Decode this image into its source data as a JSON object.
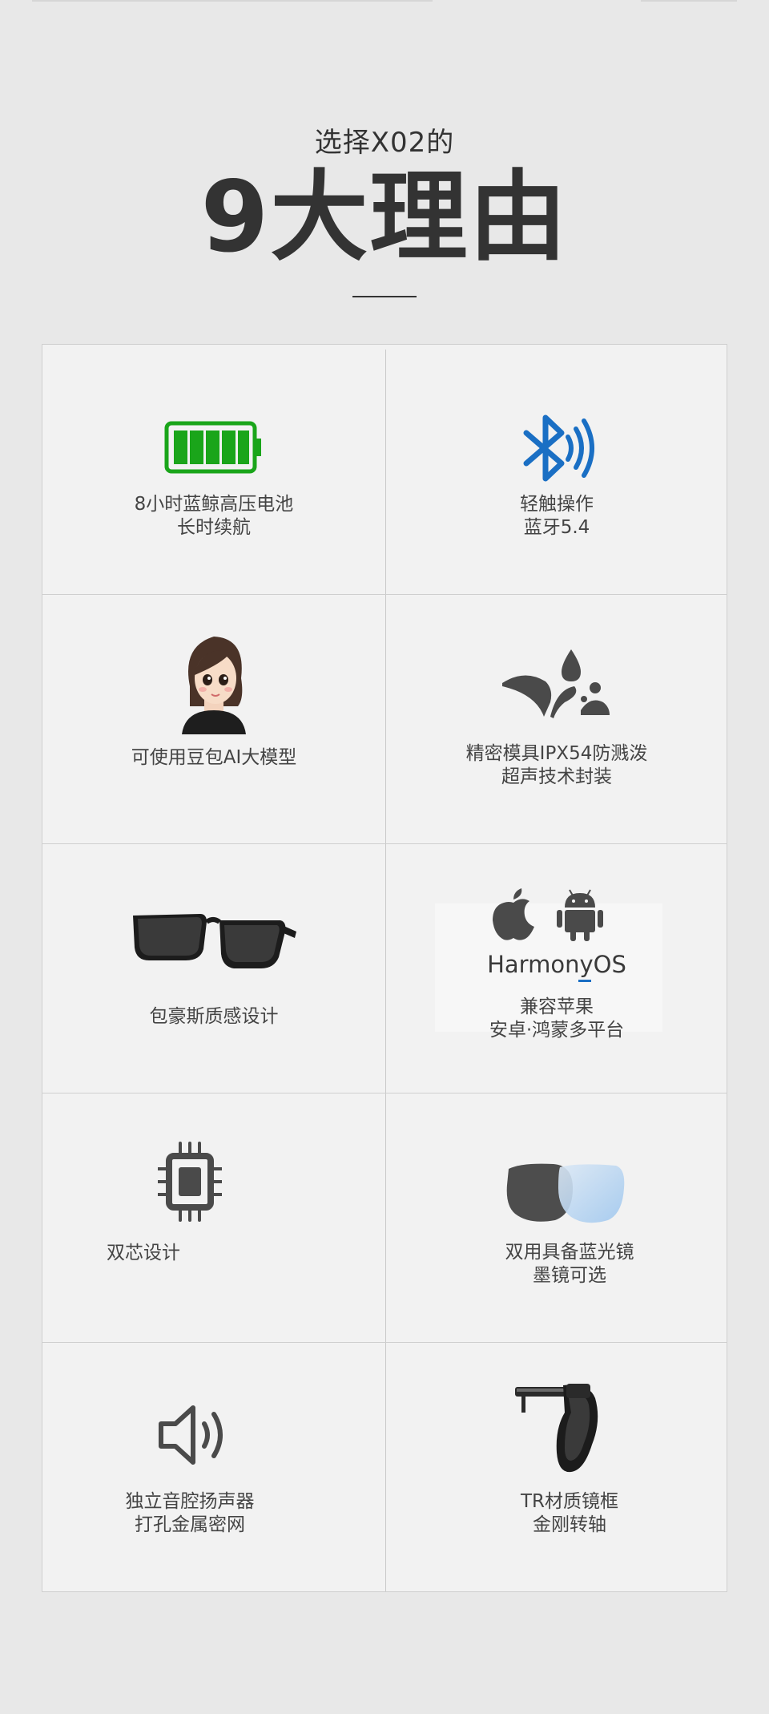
{
  "header": {
    "subtitle": "选择X02的",
    "title": "9大理由"
  },
  "features": [
    {
      "line1": "8小时蓝鲸高压电池",
      "line2": "长时续航",
      "icon": "battery-icon"
    },
    {
      "line1": "轻触操作",
      "line2": "蓝牙5.4",
      "icon": "bluetooth-icon"
    },
    {
      "line1": "可使用豆包AI大模型",
      "line2": "",
      "icon": "ai-avatar-icon"
    },
    {
      "line1": "精密模具IPX54防溅泼",
      "line2": "超声技术封装",
      "icon": "water-splash-icon"
    },
    {
      "line1": "包豪斯质感设计",
      "line2": "",
      "icon": "sunglasses-icon"
    },
    {
      "line1": "兼容苹果",
      "line2": "安卓·鸿蒙多平台",
      "icon": "platform-icons",
      "platform_text": "HarmonyOS"
    },
    {
      "line1": "双芯设计",
      "line2": "",
      "icon": "chip-icon"
    },
    {
      "line1": "双用具备蓝光镜",
      "line2": "墨镜可选",
      "icon": "lens-icon"
    },
    {
      "line1": "独立音腔扬声器",
      "line2": "打孔金属密网",
      "icon": "speaker-icon"
    },
    {
      "line1": "TR材质镜框",
      "line2": "金刚转轴",
      "icon": "hinge-icon"
    }
  ],
  "colors": {
    "battery": "#1aa51a",
    "bluetooth": "#1a6fc4",
    "icon_gray": "#4a4a4a"
  }
}
